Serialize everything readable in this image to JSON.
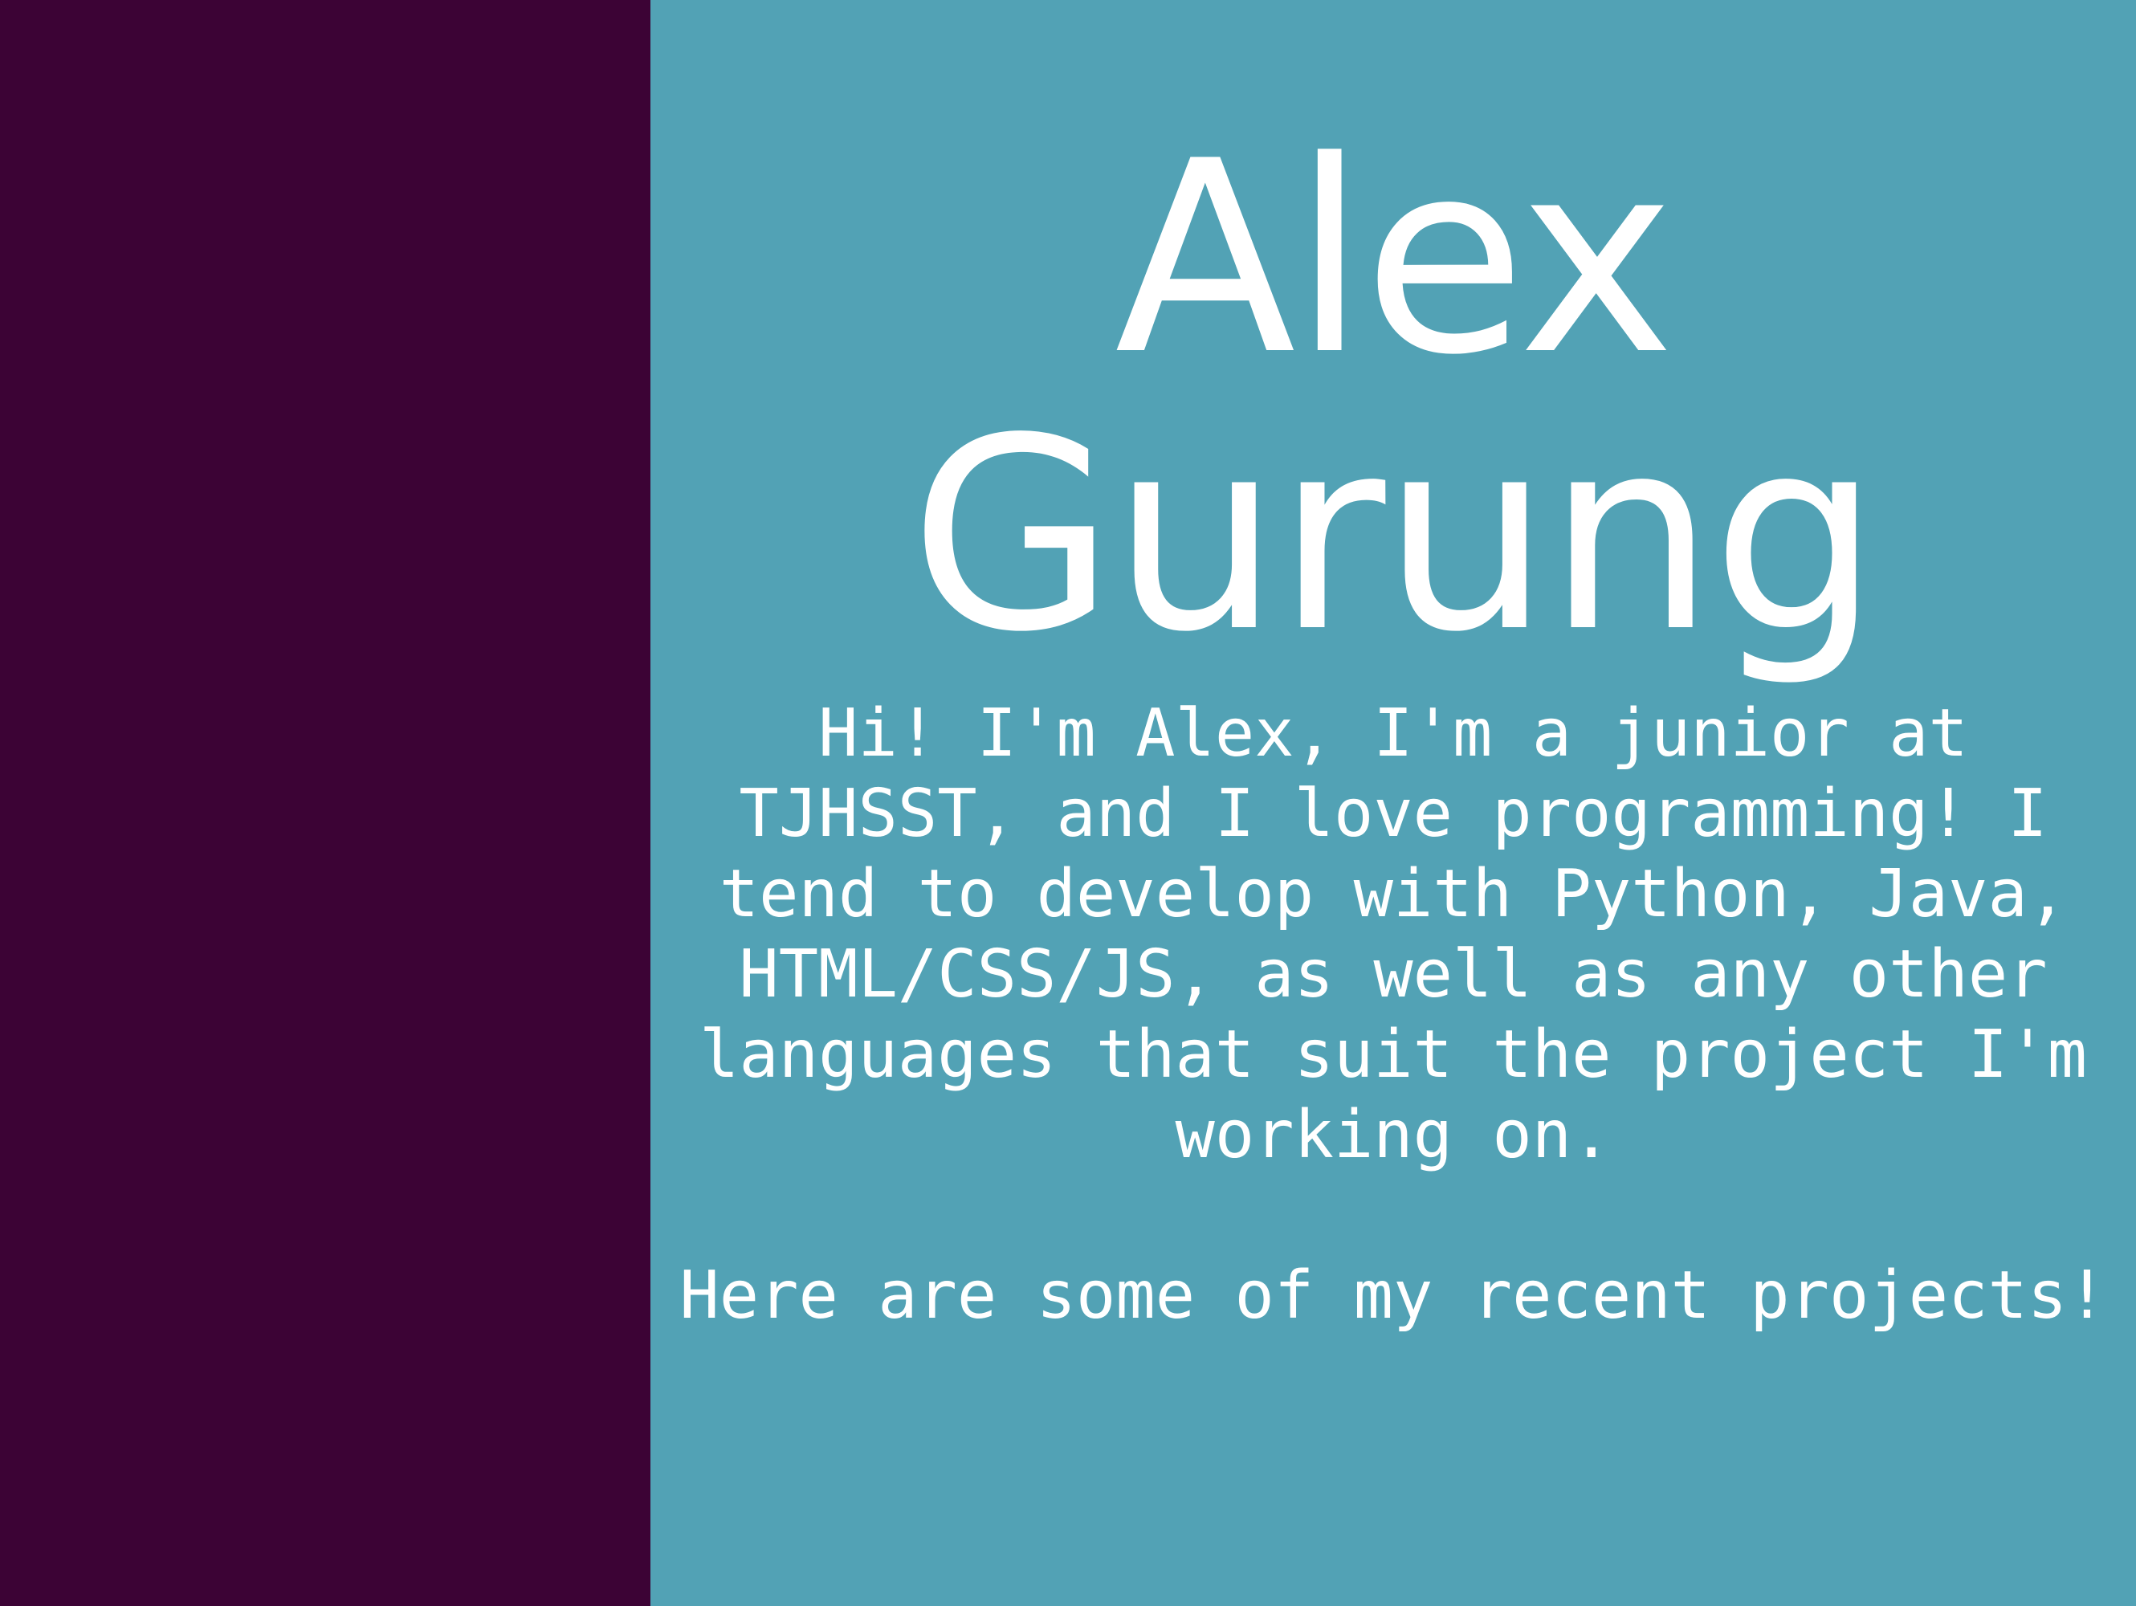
{
  "colors": {
    "sidebar_bg": "#3c0335",
    "main_bg": "#52a2b5",
    "text": "#ffffff"
  },
  "header": {
    "first_name": "Alex",
    "last_name": "Gurung"
  },
  "bio": {
    "text": "Hi! I'm Alex, I'm a junior at\nTJHSST, and I love programming! I\ntend to develop with Python, Java,\nHTML/CSS/JS, as well as any other\nlanguages that suit the project I'm\nworking on."
  },
  "projects": {
    "intro": "Here are some of my recent projects!"
  }
}
